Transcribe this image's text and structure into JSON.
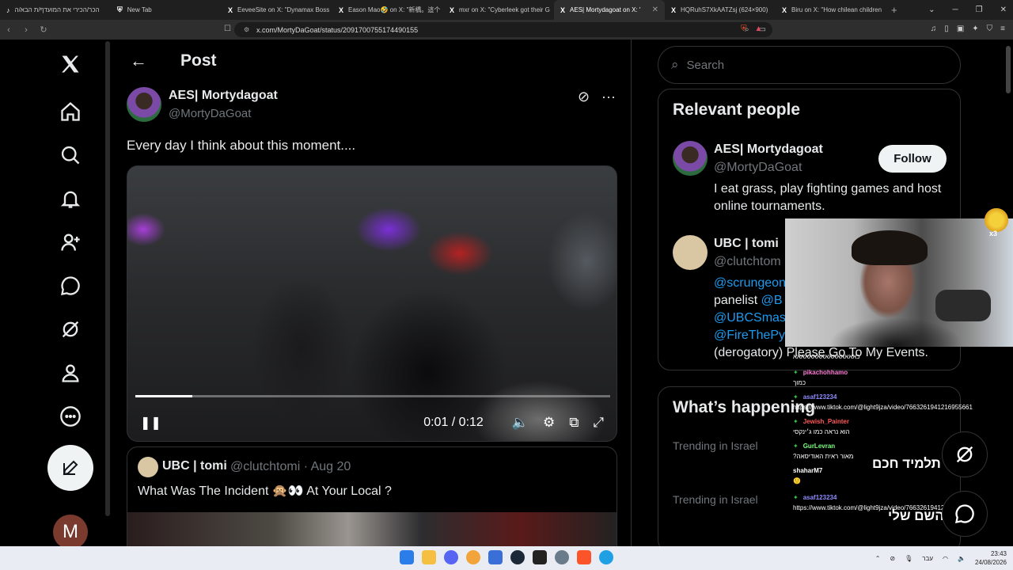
{
  "browser": {
    "tabs": [
      {
        "title": "הכר/הכירי את המועדף/ת הבא/ה",
        "fav": "♪"
      },
      {
        "title": "New Tab",
        "fav": "⛨"
      },
      {
        "title": "EeveeSite on X: \"Dynamax Boss",
        "fav": "X"
      },
      {
        "title": "Eason Mao🤣 on X: \"新橋。這个",
        "fav": "X"
      },
      {
        "title": "mxr on X: \"Cyberleek got their G",
        "fav": "X"
      },
      {
        "title": "AES| Mortydagoat on X: '",
        "fav": "X"
      },
      {
        "title": "HQRuhS7XkAATZsj (624×900)",
        "fav": "X"
      },
      {
        "title": "Biru on X: \"How chilean children",
        "fav": "X"
      }
    ],
    "url": "x.com/MortyDaGoat/status/2091700755174490155"
  },
  "nav": {
    "avatar_letter": "M"
  },
  "post": {
    "header_title": "Post",
    "author_name": "AES| Mortydagoat",
    "author_handle": "@MortyDaGoat",
    "text": "Every day I think about this moment....",
    "video": {
      "time": "0:01 / 0:12",
      "progress": 0.12
    },
    "quote": {
      "name": "UBC | tomi",
      "meta": "@clutchtomi · Aug 20",
      "text": "What Was The Incident 🙊👀 At Your Local ?"
    }
  },
  "sidebar": {
    "search_placeholder": "Search",
    "relevant_title": "Relevant people",
    "people": [
      {
        "name": "AES| Mortydagoat",
        "handle": "@MortyDaGoat",
        "bio": "I eat grass, play fighting games and host online tournaments.",
        "follow_label": "Follow"
      },
      {
        "name": "UBC | tomi",
        "handle": "@clutchtom",
        "bio_links": [
          "@scrungeon",
          "@B",
          "@UBCSmas",
          "@FireThePy"
        ],
        "bio_text_1": "panelist ",
        "bio_text_2": "(derogatory) Please Go To My Events."
      }
    ],
    "happening_title": "What’s happening",
    "trends": [
      "Trending in Israel",
      "Trending in Israel"
    ]
  },
  "stream_overlay": {
    "emote_count": "x3",
    "chat": [
      {
        "user": "",
        "msg": "כאאאאאאאאאאאאאאאא"
      },
      {
        "user": "pikachohhamo",
        "msg": "כמוך"
      },
      {
        "user": "asaf123234",
        "msg": "https://www.tiktok.com/@light9jza/video/7663261941216955661"
      },
      {
        "user": "Jewish_Painter",
        "msg": "הוא נראה כמו ג׳ינקסי"
      },
      {
        "user": "GurLevran",
        "msg": "?מאור ראית האודיסאה"
      },
      {
        "user": "shaharM7",
        "msg": "🙂"
      },
      {
        "user": "asaf123234",
        "msg": "https://www.tiktok.com/@light9jza/video/7663261941216955661"
      }
    ],
    "hebrew_1": "תלמיד חכם",
    "hebrew_2": "השם שלי"
  },
  "taskbar": {
    "time": "23:43",
    "date": "24/08/2026",
    "lang": "עבר"
  }
}
